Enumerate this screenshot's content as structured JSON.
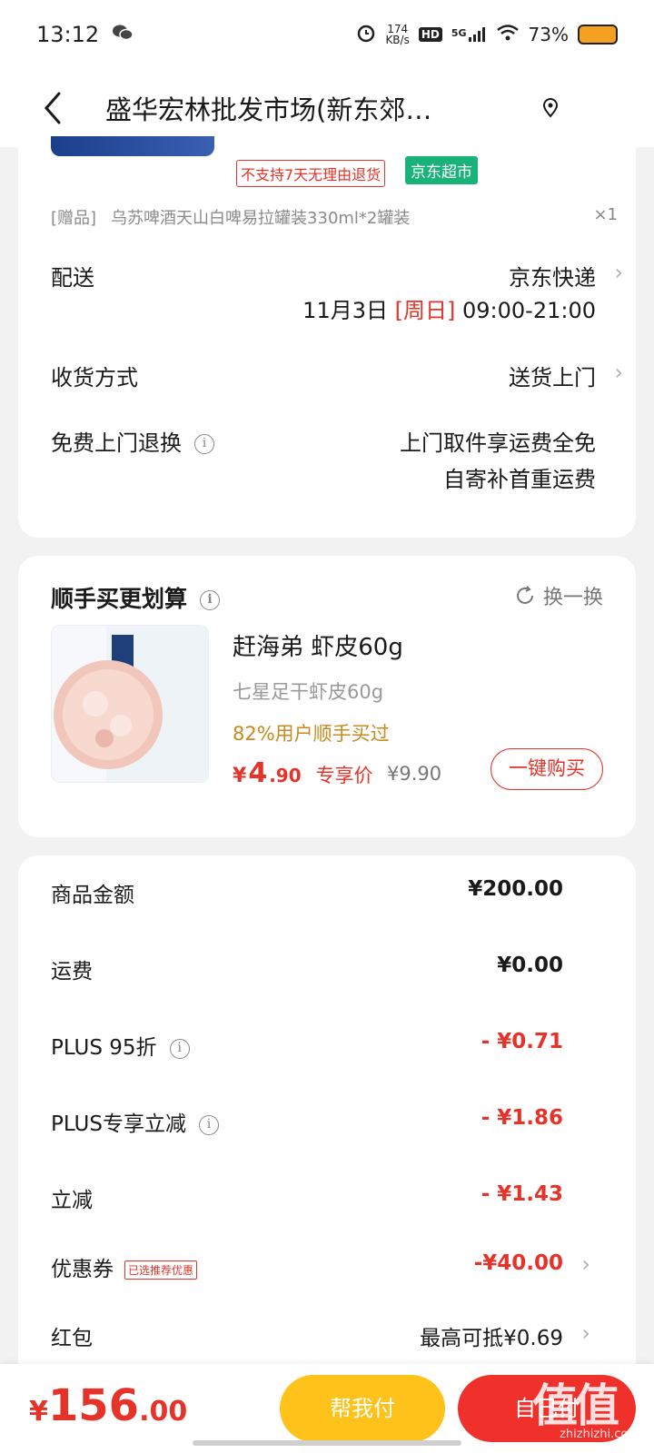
{
  "status": {
    "time": "13:12",
    "speed": "174",
    "speed_unit": "KB/s",
    "hd": "HD",
    "net": "5G",
    "battery": "73%"
  },
  "header": {
    "title": "盛华宏林批发市场(新东郊…"
  },
  "order_card": {
    "tag_noreturn": "不支持7天无理由退货",
    "tag_store": "京东超市",
    "gift_tag": "[赠品]",
    "gift_name": "乌苏啤酒天山白啤易拉罐装330ml*2罐装",
    "gift_qty": "×1",
    "delivery_label": "配送",
    "delivery_method": "京东快递",
    "delivery_date": "11月3日",
    "delivery_weekday": "[周日]",
    "delivery_time": "09:00-21:00",
    "receive_label": "收货方式",
    "receive_value": "送货上门",
    "return_label": "免费上门退换",
    "return_line1": "上门取件享运费全免",
    "return_line2": "自寄补首重运费"
  },
  "recommend": {
    "title": "顺手买更划算",
    "refresh": "换一换",
    "product_name": "赶海弟 虾皮60g",
    "product_sub": "七星足干虾皮60g",
    "product_rate": "82%用户顺手买过",
    "price_symbol": "¥",
    "price_int": "4",
    "price_dec": ".90",
    "price_label": "专享价",
    "orig_price": "¥9.90",
    "buy_button": "一键购买"
  },
  "amounts": {
    "rows": [
      {
        "label": "商品金额",
        "value": "¥200.00"
      },
      {
        "label": "运费",
        "value": "¥0.00"
      },
      {
        "label": "PLUS 95折",
        "value": "- ¥0.71"
      },
      {
        "label": "PLUS专享立减",
        "value": "- ¥1.86"
      },
      {
        "label": "立减",
        "value": "- ¥1.43"
      },
      {
        "label": "优惠券",
        "value": "-¥40.00",
        "tag": "已选推荐优惠"
      },
      {
        "label": "红包",
        "value": "最高可抵¥0.69"
      }
    ]
  },
  "bottom": {
    "total_symbol": "¥",
    "total_int": "156",
    "total_dec": ".00",
    "help_pay": "帮我付",
    "self_pay": "自己付",
    "watermark": "值值值",
    "watermark_url": "zhizhizhi.com"
  },
  "colors": {
    "accent_red": "#e5332a",
    "jd_green": "#19b37a",
    "yellow": "#ffc21a"
  }
}
